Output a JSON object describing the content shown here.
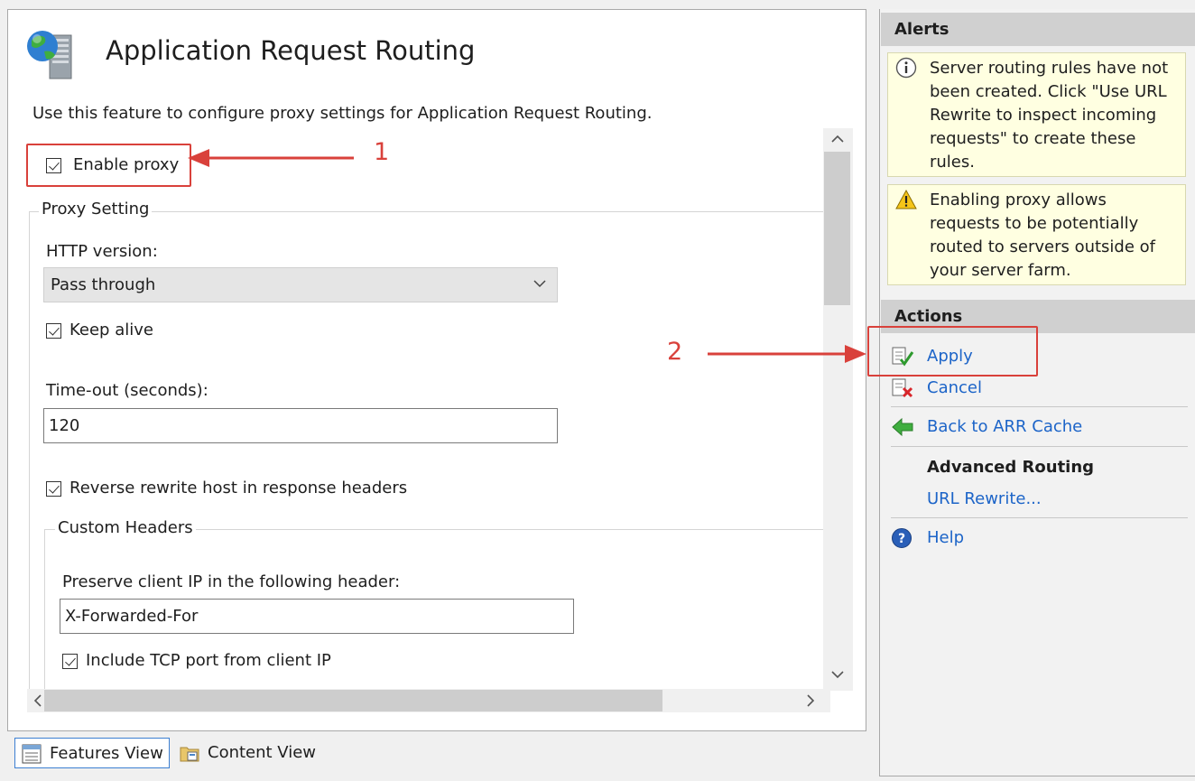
{
  "main": {
    "title": "Application Request Routing",
    "description": "Use this feature to configure proxy settings for Application Request Routing.",
    "enable_proxy_label": "Enable proxy",
    "proxy_setting_legend": "Proxy Setting",
    "http_version_label": "HTTP version:",
    "http_version_value": "Pass through",
    "keep_alive_label": "Keep alive",
    "timeout_label": "Time-out (seconds):",
    "timeout_value": "120",
    "reverse_rewrite_label": "Reverse rewrite host in response headers",
    "custom_headers_legend": "Custom Headers",
    "preserve_ip_label": "Preserve client IP in the following header:",
    "preserve_ip_value": "X-Forwarded-For",
    "include_tcp_label": "Include TCP port from client IP"
  },
  "checkboxes": {
    "enable_proxy": true,
    "keep_alive": true,
    "reverse_rewrite": true,
    "include_tcp": true
  },
  "view_tabs": {
    "features": "Features View",
    "content": "Content View",
    "active": "Features View"
  },
  "annotations": {
    "first": "1",
    "second": "2",
    "color": "#d9413b"
  },
  "right_pane": {
    "alerts_header": "Alerts",
    "alerts": [
      {
        "icon": "info-icon",
        "lines": [
          "Server routing rules have not",
          "been created. Click \"Use URL",
          "Rewrite to inspect incoming",
          "requests\" to create these",
          "rules."
        ]
      },
      {
        "icon": "warning-icon",
        "lines": [
          "Enabling proxy allows",
          "requests to be potentially",
          "routed to servers outside of",
          "your server farm."
        ]
      }
    ],
    "actions_header": "Actions",
    "actions": {
      "apply": "Apply",
      "cancel": "Cancel",
      "back": "Back to ARR Cache",
      "advanced_heading": "Advanced Routing",
      "url_rewrite": "URL Rewrite...",
      "help": "Help"
    }
  },
  "colors": {
    "link": "#1c64c8",
    "alert_bg": "#ffffe1",
    "header_bg": "#d0d0d0"
  }
}
